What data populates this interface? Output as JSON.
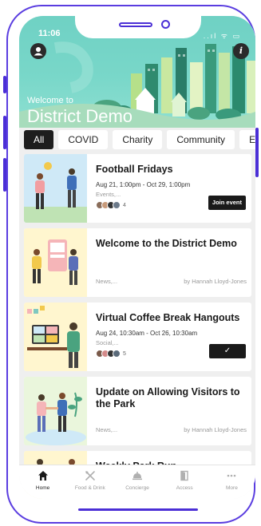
{
  "status_bar": {
    "time": "11:06",
    "icons_text": "..ıl ᯤ ▭"
  },
  "header": {
    "welcome": "Welcome to",
    "title": "District Demo"
  },
  "filters": [
    "All",
    "COVID",
    "Charity",
    "Community",
    "E"
  ],
  "cards": [
    {
      "title": "Football Fridays",
      "date": "Aug 21, 1:00pm - Oct 29, 1:00pm",
      "category": "Events,...",
      "attendee_count": "4",
      "action_label": "Join event"
    },
    {
      "title": "Welcome to the District Demo",
      "category": "News,...",
      "author": "by Hannah Lloyd-Jones"
    },
    {
      "title": "Virtual Coffee Break Hangouts",
      "date": "Aug 24, 10:30am - Oct 26, 10:30am",
      "category": "Social,...",
      "attendee_count": "5",
      "action_label": "✓"
    },
    {
      "title": "Update on Allowing Visitors to the Park",
      "category": "News,...",
      "author": "by Hannah Lloyd-Jones"
    },
    {
      "title": "Weekly Park Run"
    }
  ],
  "nav": [
    {
      "label": "Home",
      "icon": "home-icon"
    },
    {
      "label": "Food & Drink",
      "icon": "utensils-icon"
    },
    {
      "label": "Concierge",
      "icon": "bell-icon"
    },
    {
      "label": "Access",
      "icon": "door-icon"
    },
    {
      "label": "More",
      "icon": "more-icon"
    }
  ],
  "colors": {
    "accent": "#5a3de0",
    "header": "#79d7c9",
    "dark": "#1a1a1a"
  }
}
